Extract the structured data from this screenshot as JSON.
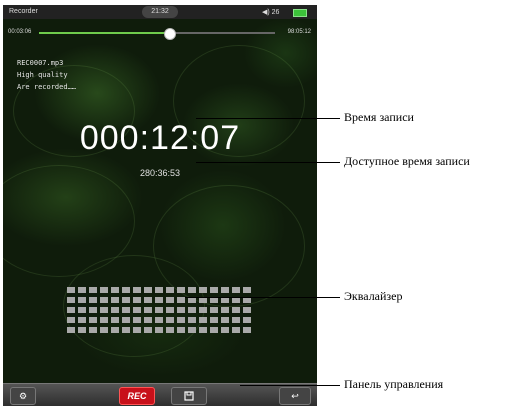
{
  "status_bar": {
    "app_name": "Recorder",
    "clock": "21:32",
    "volume": "◀) 26"
  },
  "playback": {
    "elapsed": "00:03:06",
    "total": "98:05:12",
    "progress": 0.55
  },
  "file_info": {
    "filename": "REC0007.mp3",
    "quality": "High quality",
    "status": "Are recorded……"
  },
  "timer": {
    "record_time": "000:12:07",
    "available_time": "280:36:53"
  },
  "equalizer": {
    "columns": 17,
    "rows": 5
  },
  "toolbar": {
    "rec_label": "REC",
    "settings_icon": "gear-icon",
    "save_icon": "save-icon",
    "back_icon": "return-icon"
  },
  "callouts": {
    "record_time": "Время записи",
    "available_time": "Доступное время записи",
    "equalizer": "Эквалайзер",
    "control_panel": "Панель управления"
  },
  "colors": {
    "accent_green": "#6fcb4c",
    "rec_red": "#c8101a",
    "battery_green": "#3cc23a"
  }
}
